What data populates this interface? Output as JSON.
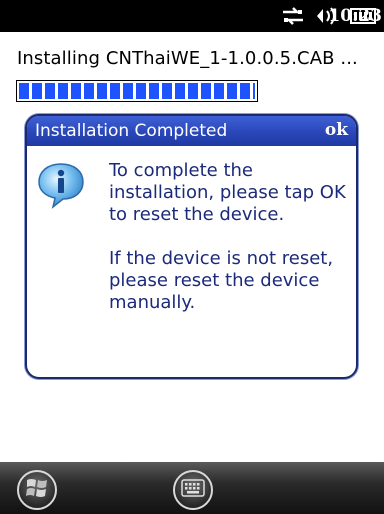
{
  "status_bar": {
    "time": "10:23",
    "icons": [
      "data-sync-icon",
      "volume-icon",
      "battery-icon"
    ]
  },
  "install": {
    "text": "Installing CNThaiWE_1-1.0.0.5.CAB ...",
    "progress_percent": 100
  },
  "dialog": {
    "title": "Installation Completed",
    "ok_label": "ok",
    "icon": "info-icon",
    "message_line1": "To complete the installation, please tap OK to reset the device.",
    "message_line2": "If the device is not reset, please reset the device manually."
  },
  "taskbar": {
    "icons": [
      "windows-start-icon",
      "keyboard-icon"
    ]
  },
  "colors": {
    "progress": "#1f53ff",
    "titlebar": "#2a47b9",
    "message_text": "#1b2a7a"
  }
}
